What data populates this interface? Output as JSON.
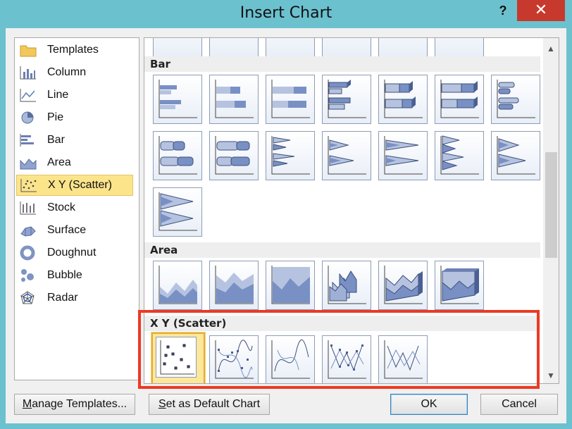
{
  "window": {
    "title": "Insert Chart",
    "help_label": "?",
    "close_label": "✕",
    "accent_color": "#6cc1cf",
    "close_color": "#c7392c"
  },
  "chart_types": [
    {
      "label": "Templates",
      "icon": "folder-icon"
    },
    {
      "label": "Column",
      "icon": "column-chart-icon"
    },
    {
      "label": "Line",
      "icon": "line-chart-icon"
    },
    {
      "label": "Pie",
      "icon": "pie-chart-icon"
    },
    {
      "label": "Bar",
      "icon": "bar-chart-icon"
    },
    {
      "label": "Area",
      "icon": "area-chart-icon"
    },
    {
      "label": "X Y (Scatter)",
      "icon": "scatter-chart-icon",
      "selected": true
    },
    {
      "label": "Stock",
      "icon": "stock-chart-icon"
    },
    {
      "label": "Surface",
      "icon": "surface-chart-icon"
    },
    {
      "label": "Doughnut",
      "icon": "doughnut-chart-icon"
    },
    {
      "label": "Bubble",
      "icon": "bubble-chart-icon"
    },
    {
      "label": "Radar",
      "icon": "radar-chart-icon"
    }
  ],
  "sections": {
    "bar": {
      "label": "Bar"
    },
    "area": {
      "label": "Area"
    },
    "scatter": {
      "label": "X Y (Scatter)"
    }
  },
  "scrollbar": {
    "up": "▲",
    "down": "▼"
  },
  "buttons": {
    "manage_templates_pre": "",
    "manage_templates_mnemonic": "M",
    "manage_templates_post": "anage Templates...",
    "set_default_pre": "",
    "set_default_mnemonic": "S",
    "set_default_post": "et as Default Chart",
    "ok": "OK",
    "cancel": "Cancel"
  },
  "highlight_color": "#ec3a24"
}
